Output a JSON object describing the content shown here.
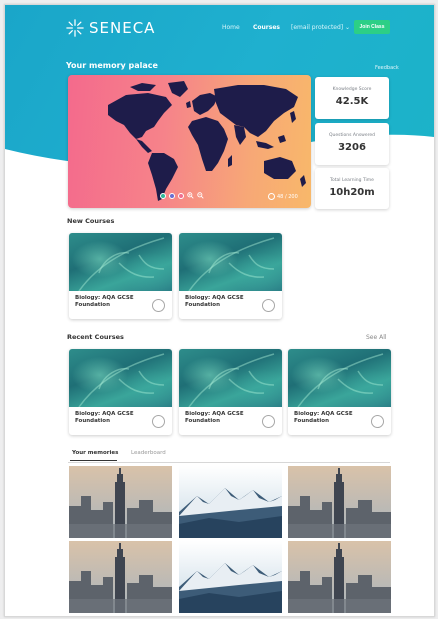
{
  "app": {
    "name": "SENECA"
  },
  "nav": {
    "home": "Home",
    "courses": "Courses",
    "email": "[email protected] ⌄",
    "join_class": "Join Class"
  },
  "memory_palace": {
    "title": "Your memory palace",
    "feedback": "Feedback"
  },
  "map": {
    "count": "48 / 200"
  },
  "stats": [
    {
      "label": "Knowledge Score",
      "value": "42.5K"
    },
    {
      "label": "Questions Answered",
      "value": "3206"
    },
    {
      "label": "Total Learning Time",
      "value": "10h20m"
    }
  ],
  "new_courses": {
    "title": "New Courses",
    "items": [
      {
        "name": "Biology: AQA GCSE Foundation"
      },
      {
        "name": "Biology: AQA GCSE Foundation"
      }
    ]
  },
  "recent_courses": {
    "title": "Recent Courses",
    "see_all": "See All",
    "items": [
      {
        "name": "Biology: AQA GCSE Foundation"
      },
      {
        "name": "Biology: AQA GCSE Foundation"
      },
      {
        "name": "Biology: AQA GCSE Foundation"
      }
    ]
  },
  "tabs": {
    "memories": "Your memories",
    "leaderboard": "Leaderboard"
  },
  "memories": [
    "city",
    "mountains",
    "city",
    "city",
    "mountains",
    "city"
  ]
}
